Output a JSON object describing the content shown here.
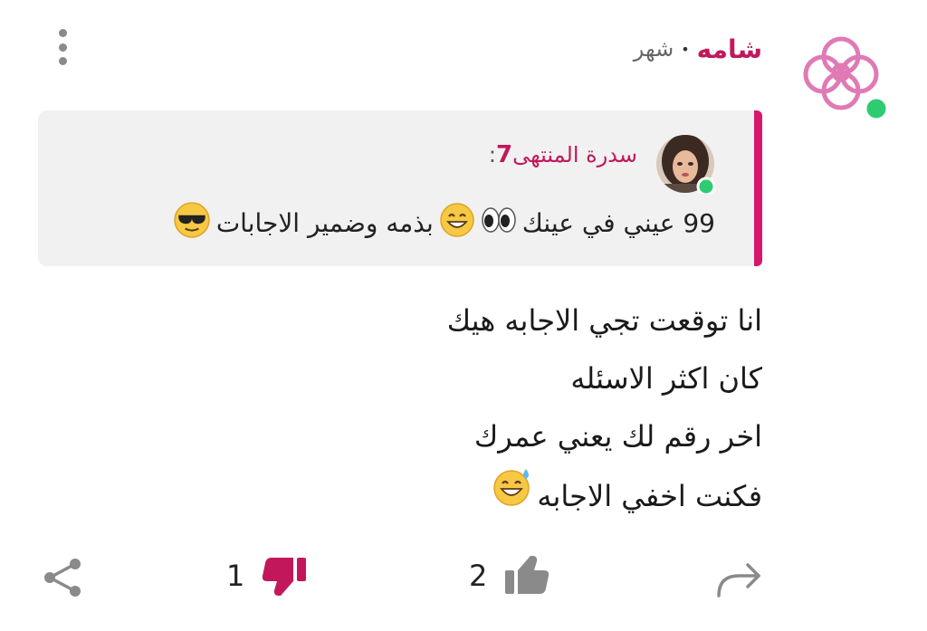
{
  "post": {
    "author": "شامه",
    "separator": "•",
    "time": "شهر",
    "online": true
  },
  "quote": {
    "author_name": "سدرة المنتهى",
    "author_suffix": "7",
    "colon": ":",
    "text_parts": [
      "99 عيني في عينك",
      "بذمه وضمير الاجابات"
    ],
    "emojis": [
      "sunglasses-emoji",
      "grinning-emoji",
      "eyes-emoji"
    ]
  },
  "body": {
    "lines": [
      "انا توقعت تجي الاجابه هيك",
      "كان اكثر الاسئله",
      "اخر رقم لك يعني عمرك",
      "فكنت اخفي الاجابه"
    ]
  },
  "actions": {
    "likes": "2",
    "dislikes": "1"
  },
  "colors": {
    "accent": "#c2185b",
    "online": "#2ecc71",
    "quote_bg": "#f1f1f1",
    "icon_gray": "#8a8a8a"
  }
}
